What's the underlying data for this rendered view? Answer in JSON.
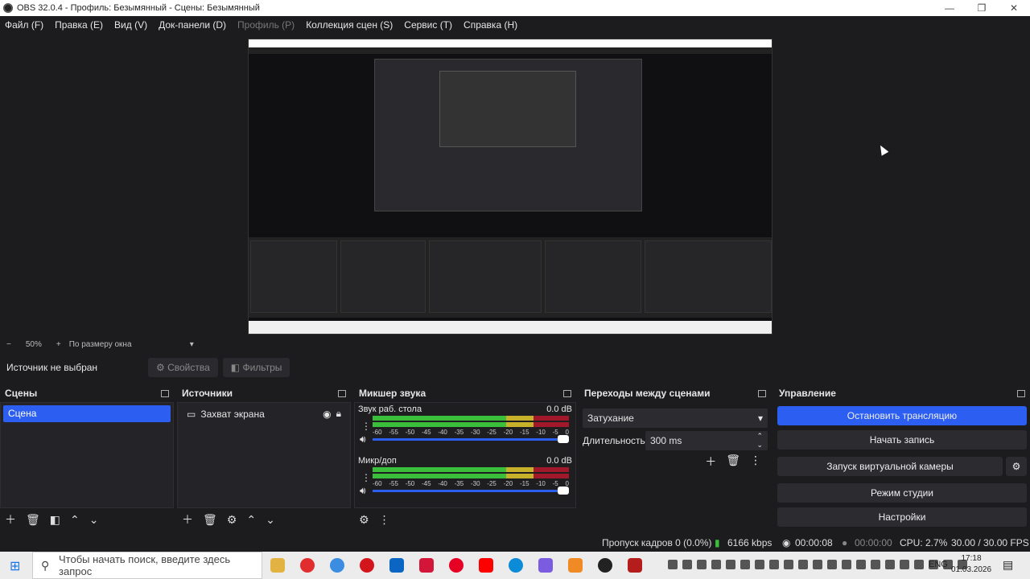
{
  "window": {
    "title": "OBS 32.0.4 - Профиль: Безымянный - Сцены: Безымянный"
  },
  "menu": {
    "items": [
      "Файл (F)",
      "Правка (E)",
      "Вид (V)",
      "Док-панели (D)",
      "Профиль (P)",
      "Коллекция сцен (S)",
      "Сервис (T)",
      "Справка (H)"
    ]
  },
  "zoom": {
    "value": "50%",
    "fit": "По размеру окна"
  },
  "source_bar": {
    "none": "Источник не выбран",
    "props": "Свойства",
    "filters": "Фильтры"
  },
  "scenes": {
    "title": "Сцены",
    "items": [
      "Сцена"
    ]
  },
  "sources": {
    "title": "Источники",
    "items": [
      "Захват экрана"
    ]
  },
  "mixer": {
    "title": "Микшер звука",
    "channels": [
      {
        "name": "Звук раб. стола",
        "db": "0.0 dB"
      },
      {
        "name": "Микр/доп",
        "db": "0.0 dB"
      }
    ],
    "ticks": [
      "-60",
      "-55",
      "-50",
      "-45",
      "-40",
      "-35",
      "-30",
      "-25",
      "-20",
      "-15",
      "-10",
      "-5",
      "0"
    ]
  },
  "transitions": {
    "title": "Переходы между сценами",
    "type": "Затухание",
    "duration_label": "Длительность",
    "duration": "300 ms"
  },
  "controls": {
    "title": "Управление",
    "stop_stream": "Остановить трансляцию",
    "start_record": "Начать запись",
    "virtual_cam": "Запуск виртуальной камеры",
    "studio": "Режим студии",
    "settings": "Настройки"
  },
  "status": {
    "dropped": "Пропуск кадров 0 (0.0%)",
    "kbps": "6166 kbps",
    "stream_time": "00:00:08",
    "rec_time": "00:00:00",
    "cpu": "CPU: 2.7%",
    "fps": "30.00 / 30.00 FPS"
  },
  "taskbar": {
    "search": "Чтобы начать поиск, введите здесь запрос",
    "lang": "ENG",
    "time": "17:18",
    "date": "01.03.2026"
  },
  "colors": {
    "accent": "#2c5ff1",
    "bg": "#1c1c1f"
  }
}
